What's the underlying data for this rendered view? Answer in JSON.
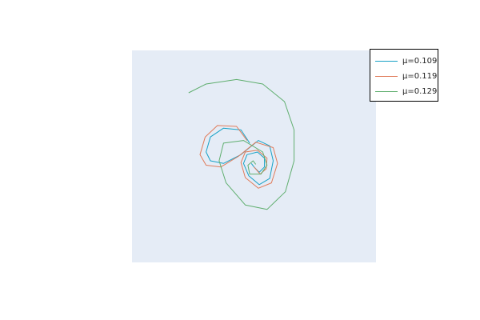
{
  "chart_data": {
    "type": "line",
    "title": "",
    "xlabel": "",
    "ylabel": "",
    "grid": false,
    "axes_visible": false,
    "background": "#e5ecf6",
    "xlim": [
      -1.4,
      1.4
    ],
    "ylim": [
      -1.2,
      1.2
    ],
    "legend": {
      "placement": "top-right"
    },
    "series": [
      {
        "name": "μ=0.109",
        "color": "#17a1c6",
        "x": [
          -0.05,
          -0.15,
          -0.35,
          -0.5,
          -0.55,
          -0.5,
          -0.35,
          -0.15,
          0.05,
          0.18,
          0.22,
          0.18,
          0.06,
          -0.06,
          -0.12,
          -0.08,
          0.04,
          0.12,
          0.12,
          0.06,
          0.0,
          -0.03
        ],
        "y": [
          0.15,
          0.3,
          0.32,
          0.22,
          0.05,
          -0.05,
          -0.08,
          0.02,
          0.18,
          0.12,
          -0.05,
          -0.25,
          -0.32,
          -0.22,
          -0.08,
          0.02,
          0.05,
          -0.02,
          -0.12,
          -0.18,
          -0.12,
          -0.08
        ]
      },
      {
        "name": "μ=0.119",
        "color": "#e07b5a",
        "x": [
          -0.08,
          -0.2,
          -0.42,
          -0.56,
          -0.62,
          -0.55,
          -0.38,
          -0.18,
          0.02,
          0.22,
          0.27,
          0.2,
          0.05,
          -0.1,
          -0.15,
          -0.1,
          0.04,
          0.15,
          0.14,
          0.07,
          0.0
        ],
        "y": [
          0.18,
          0.34,
          0.35,
          0.22,
          0.02,
          -0.1,
          -0.12,
          0.0,
          0.16,
          0.1,
          -0.08,
          -0.3,
          -0.36,
          -0.24,
          -0.07,
          0.05,
          0.07,
          -0.02,
          -0.14,
          -0.2,
          -0.12
        ]
      },
      {
        "name": "μ=0.129",
        "color": "#5fae6e",
        "x": [
          -0.75,
          -0.55,
          -0.2,
          0.1,
          0.35,
          0.46,
          0.46,
          0.36,
          0.15,
          -0.1,
          -0.32,
          -0.4,
          -0.35,
          -0.12,
          0.1,
          0.15,
          0.08,
          -0.05,
          -0.07,
          -0.01,
          0.02
        ],
        "y": [
          0.72,
          0.82,
          0.87,
          0.82,
          0.62,
          0.3,
          -0.05,
          -0.4,
          -0.6,
          -0.55,
          -0.3,
          -0.05,
          0.15,
          0.18,
          0.05,
          -0.1,
          -0.2,
          -0.2,
          -0.1,
          -0.05,
          -0.09
        ]
      }
    ]
  }
}
